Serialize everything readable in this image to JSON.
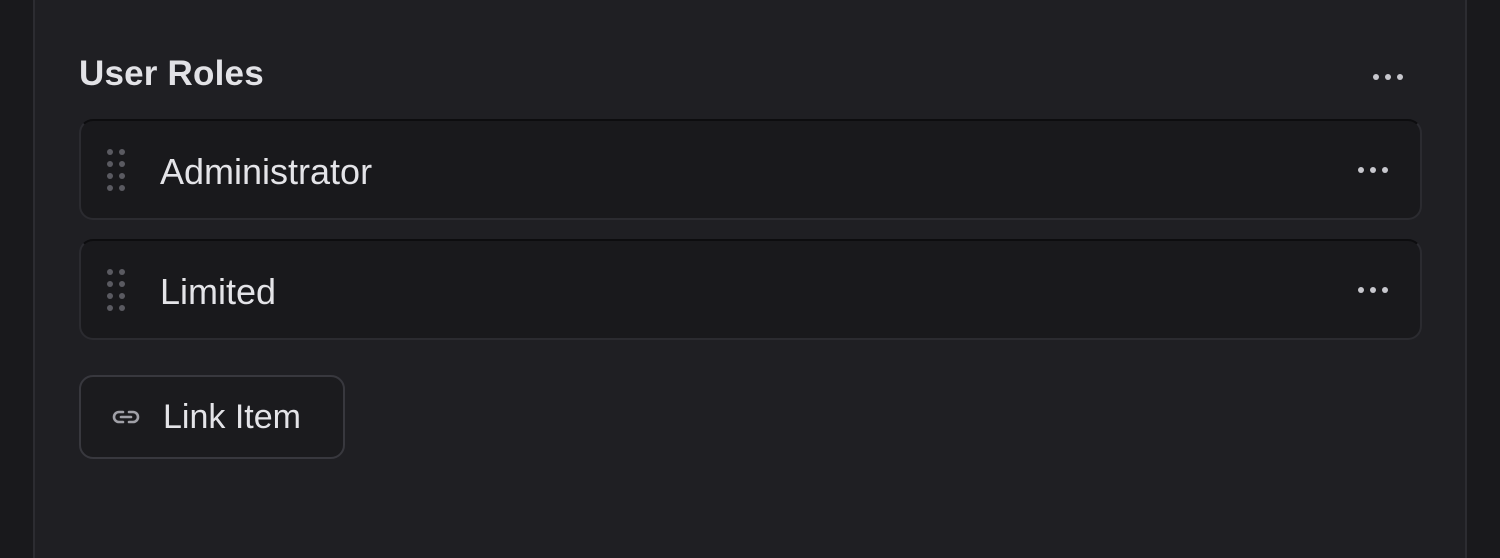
{
  "section": {
    "title": "User Roles",
    "more_icon": "more-horizontal-icon"
  },
  "roles": [
    {
      "label": "Administrator",
      "handle_icon": "drag-handle-icon",
      "more_icon": "more-horizontal-icon"
    },
    {
      "label": "Limited",
      "handle_icon": "drag-handle-icon",
      "more_icon": "more-horizontal-icon"
    }
  ],
  "link_button": {
    "label": "Link Item",
    "icon": "link-icon"
  },
  "colors": {
    "background": "#19191c",
    "panel": "#1f1f23",
    "text": "#e4e4e8",
    "muted": "#5a5a61"
  }
}
